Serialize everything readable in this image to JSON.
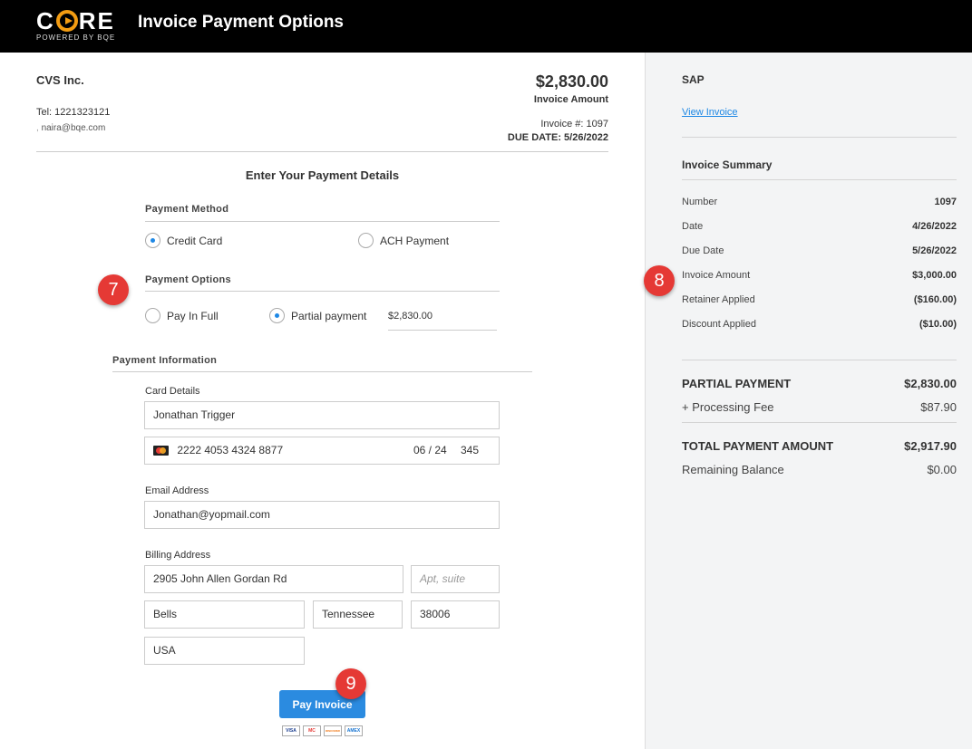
{
  "header": {
    "logo_text_c": "C",
    "logo_text_re": "RE",
    "logo_sub": "POWERED BY BQE",
    "title": "Invoice Payment Options"
  },
  "client": {
    "name": "CVS Inc.",
    "tel": "Tel: 1221323121",
    "email": "naira@bqe.com"
  },
  "invoice": {
    "amount": "$2,830.00",
    "amount_label": "Invoice Amount",
    "number_text": "Invoice #: 1097",
    "due_text": "DUE DATE: 5/26/2022"
  },
  "form": {
    "heading": "Enter Your Payment Details",
    "payment_method_label": "Payment Method",
    "credit_card_label": "Credit Card",
    "ach_label": "ACH Payment",
    "payment_options_label": "Payment Options",
    "pay_in_full_label": "Pay In Full",
    "partial_label": "Partial payment",
    "partial_amount": "$2,830.00",
    "payment_info_label": "Payment Information",
    "card_details_label": "Card Details",
    "card_name": "Jonathan Trigger",
    "card_number": "2222 4053 4324 8877",
    "card_expiry": "06 / 24",
    "card_cvc": "345",
    "email_label": "Email Address",
    "email_value": "Jonathan@yopmail.com",
    "billing_label": "Billing Address",
    "street": "2905 John Allen Gordan Rd",
    "apt_placeholder": "Apt, suite",
    "city": "Bells",
    "state": "Tennessee",
    "zip": "38006",
    "country": "USA",
    "pay_button": "Pay Invoice",
    "card_brands": [
      "VISA",
      "MC",
      "DISCOVER",
      "AMEX"
    ]
  },
  "badges": {
    "b7": "7",
    "b8": "8",
    "b9": "9"
  },
  "sidebar": {
    "company": "SAP",
    "view_invoice": "View Invoice",
    "summary_title": "Invoice Summary",
    "rows": [
      {
        "label": "Number",
        "value": "1097"
      },
      {
        "label": "Date",
        "value": "4/26/2022"
      },
      {
        "label": "Due Date",
        "value": "5/26/2022"
      },
      {
        "label": "Invoice Amount",
        "value": "$3,000.00"
      },
      {
        "label": "Retainer Applied",
        "value": "($160.00)"
      },
      {
        "label": "Discount Applied",
        "value": "($10.00)"
      }
    ],
    "partial_label": "PARTIAL PAYMENT",
    "partial_value": "$2,830.00",
    "fee_label": "+ Processing Fee",
    "fee_value": "$87.90",
    "total_label": "TOTAL PAYMENT AMOUNT",
    "total_value": "$2,917.90",
    "remaining_label": "Remaining Balance",
    "remaining_value": "$0.00"
  },
  "colors": {
    "accent": "#2b8be0",
    "logo_orange": "#f39c12",
    "badge_red": "#e53935"
  }
}
